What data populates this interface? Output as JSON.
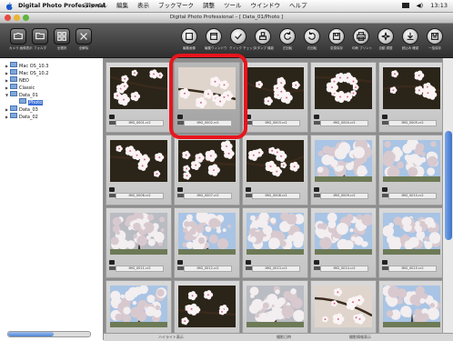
{
  "menubar": {
    "app_name": "Digital Photo Professional",
    "menus": [
      "ファイル",
      "編集",
      "表示",
      "ブックマーク",
      "調整",
      "ツール",
      "ウインドウ",
      "ヘルプ"
    ],
    "clock": "13:13"
  },
  "window": {
    "title": "Digital Photo Professional – [ Data_01/Photo ]"
  },
  "toolbar": {
    "left_buttons": [
      {
        "label": "カメラ 画像表示",
        "icon": "camera-icon"
      },
      {
        "label": "フォルダ",
        "icon": "folder-icon"
      },
      {
        "label": "全選択",
        "icon": "select-all-icon"
      },
      {
        "label": "全解除",
        "icon": "deselect-icon"
      }
    ],
    "right_buttons": [
      {
        "label": "編集画像",
        "icon": "edit-image-icon"
      },
      {
        "label": "編集ウィンドウ",
        "icon": "edit-window-icon"
      },
      {
        "label": "クイック チェック",
        "icon": "quick-check-icon"
      },
      {
        "label": "スタンプ 機能",
        "icon": "stamp-icon"
      },
      {
        "label": "左回転",
        "icon": "rotate-left-icon"
      },
      {
        "label": "右回転",
        "icon": "rotate-right-icon"
      },
      {
        "label": "変換保存",
        "icon": "convert-save-icon"
      },
      {
        "label": "印刷 プリント",
        "icon": "print-icon"
      },
      {
        "label": "自動 調整",
        "icon": "auto-adjust-icon"
      },
      {
        "label": "読込み 確認",
        "icon": "import-icon"
      },
      {
        "label": "一括保存",
        "icon": "batch-save-icon"
      }
    ]
  },
  "sidebar": {
    "tree": [
      {
        "label": "Mac OS_10.3",
        "depth": 0,
        "expanded": false,
        "selected": false
      },
      {
        "label": "Mac OS_10.2",
        "depth": 0,
        "expanded": false,
        "selected": false
      },
      {
        "label": "NEO",
        "depth": 0,
        "expanded": false,
        "selected": false
      },
      {
        "label": "Classic",
        "depth": 0,
        "expanded": false,
        "selected": false
      },
      {
        "label": "Data_01",
        "depth": 0,
        "expanded": true,
        "selected": false
      },
      {
        "label": "Photo",
        "depth": 1,
        "expanded": false,
        "selected": true
      },
      {
        "label": "Data_03",
        "depth": 0,
        "expanded": false,
        "selected": false
      },
      {
        "label": "Data_02",
        "depth": 0,
        "expanded": false,
        "selected": false
      }
    ]
  },
  "grid": {
    "thumbnails": [
      {
        "filename": "IMG_0001.cr2",
        "scene": "branch-dark",
        "selected": false
      },
      {
        "filename": "IMG_0002.cr2",
        "scene": "blossom-bright",
        "selected": true
      },
      {
        "filename": "IMG_0003.cr2",
        "scene": "branch-dark",
        "selected": false
      },
      {
        "filename": "IMG_0004.cr2",
        "scene": "ring-dark",
        "selected": false
      },
      {
        "filename": "IMG_0005.cr2",
        "scene": "branch-dark",
        "selected": false
      },
      {
        "filename": "IMG_0006.cr2",
        "scene": "flowers-dark",
        "selected": false
      },
      {
        "filename": "IMG_0007.cr2",
        "scene": "flowers-dark",
        "selected": false
      },
      {
        "filename": "IMG_0008.cr2",
        "scene": "blossom-dark",
        "selected": false
      },
      {
        "filename": "IMG_0009.cr2",
        "scene": "tree-sky",
        "selected": false
      },
      {
        "filename": "IMG_0010.cr2",
        "scene": "tree-sky",
        "selected": false
      },
      {
        "filename": "IMG_0011.cr2",
        "scene": "tree-grey",
        "selected": false
      },
      {
        "filename": "IMG_0012.cr2",
        "scene": "tree-sky",
        "selected": false
      },
      {
        "filename": "IMG_0013.cr2",
        "scene": "tree-portrait",
        "selected": false
      },
      {
        "filename": "IMG_0014.cr2",
        "scene": "tree-portrait",
        "selected": false
      },
      {
        "filename": "IMG_0015.cr2",
        "scene": "tree-sky",
        "selected": false
      },
      {
        "filename": "IMG_0016.cr2",
        "scene": "tree-portrait",
        "selected": false
      },
      {
        "filename": "IMG_0017.cr2",
        "scene": "flowers-dark",
        "selected": false
      },
      {
        "filename": "IMG_0018.cr2",
        "scene": "tree-grey",
        "selected": false
      },
      {
        "filename": "IMG_0019.cr2",
        "scene": "blossom-bright",
        "selected": false
      },
      {
        "filename": "IMG_0020.cr2",
        "scene": "tree-sky",
        "selected": false
      }
    ]
  },
  "statusbar": {
    "left": "ハイライト表示",
    "mid": "撮影日時",
    "right": "撮影情報表示"
  },
  "colors": {
    "highlight": "#e8141c",
    "toolbar": "#3f3f3f",
    "grid_bg": "#8c8c8c"
  }
}
